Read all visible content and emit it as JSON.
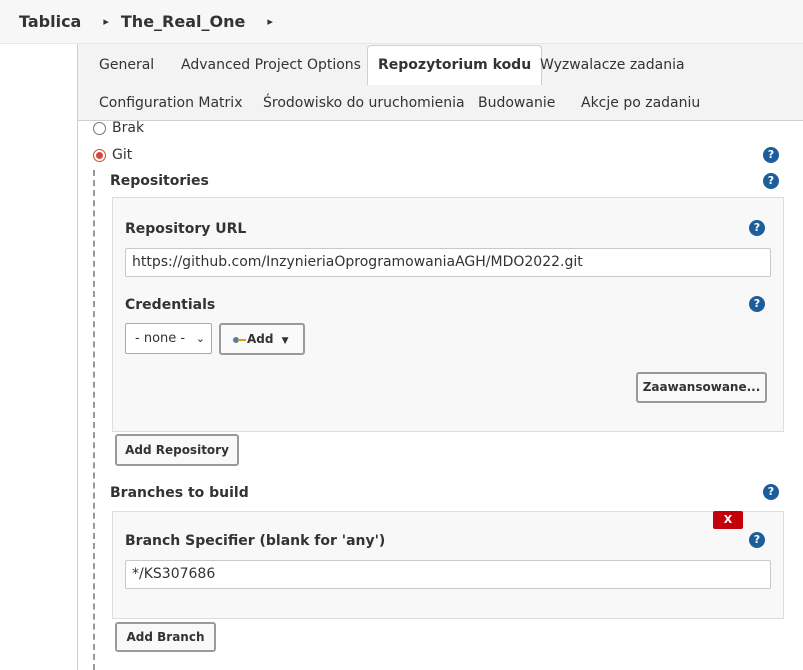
{
  "breadcrumb": {
    "items": [
      "Tablica",
      "The_Real_One"
    ]
  },
  "tabs": [
    {
      "label": "General"
    },
    {
      "label": "Advanced Project Options"
    },
    {
      "label": "Repozytorium kodu",
      "active": true
    },
    {
      "label": "Wyzwalacze zadania"
    },
    {
      "label": "Configuration Matrix"
    },
    {
      "label": "Środowisko do uruchomienia"
    },
    {
      "label": "Budowanie"
    },
    {
      "label": "Akcje po zadaniu"
    }
  ],
  "scm": {
    "options": [
      {
        "label": "Brak",
        "selected": false
      },
      {
        "label": "Git",
        "selected": true
      }
    ]
  },
  "repositories": {
    "section_label": "Repositories",
    "url_label": "Repository URL",
    "url_value": "https://github.com/InzynieriaOprogramowaniaAGH/MDO2022.git",
    "credentials_label": "Credentials",
    "credentials_selected": "- none -",
    "add_label": "Add",
    "advanced_label": "Zaawansowane...",
    "add_repository_label": "Add Repository"
  },
  "branches": {
    "section_label": "Branches to build",
    "specifier_label": "Branch Specifier (blank for 'any')",
    "specifier_value": "*/KS307686",
    "delete_label": "X",
    "add_branch_label": "Add Branch"
  },
  "help_icon_glyph": "?",
  "colors": {
    "radio_accent": "#d24939",
    "help_icon": "#1d5e9a",
    "delete_button": "#c4000a"
  }
}
